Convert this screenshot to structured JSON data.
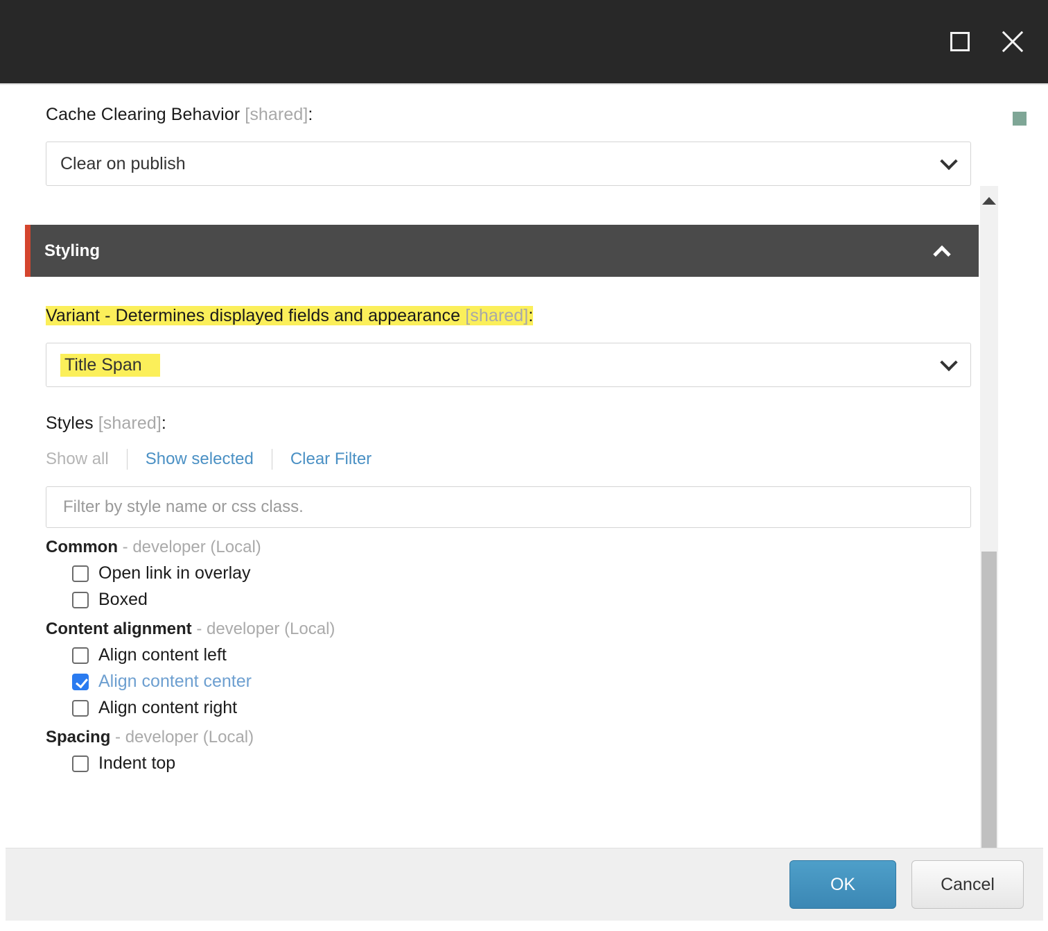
{
  "titlebar": {
    "maximize_icon": "maximize-square-icon",
    "close_icon": "close-x-icon"
  },
  "fields": {
    "cache_clearing": {
      "label": "Cache Clearing Behavior ",
      "label_shared": "[shared]",
      "label_colon": ":",
      "value": "Clear on publish",
      "chevron_icon": "chevron-down-icon"
    }
  },
  "section": {
    "title": "Styling",
    "accent_color": "#d4452e",
    "collapse_icon": "chevron-up-icon",
    "expanded": true
  },
  "variant": {
    "label": "Variant - Determines displayed fields and appearance ",
    "label_shared": "[shared]",
    "label_colon": ":",
    "value": "Title Span",
    "chevron_icon": "chevron-down-icon",
    "highlight_color": "#fbef5a"
  },
  "styles": {
    "label": "Styles ",
    "label_shared": "[shared]",
    "label_colon": ":",
    "links": {
      "show_all": "Show all",
      "show_selected": "Show selected",
      "clear_filter": "Clear Filter"
    },
    "filter_placeholder": "Filter by style name or css class.",
    "filter_value": "",
    "groups": [
      {
        "name": "Common",
        "meta": " - developer (Local)",
        "options": [
          {
            "label": "Open link in overlay",
            "checked": false
          },
          {
            "label": "Boxed",
            "checked": false
          }
        ]
      },
      {
        "name": "Content alignment",
        "meta": " - developer (Local)",
        "options": [
          {
            "label": "Align content left",
            "checked": false
          },
          {
            "label": "Align content center",
            "checked": true
          },
          {
            "label": "Align content right",
            "checked": false
          }
        ]
      },
      {
        "name": "Spacing",
        "meta": " - developer (Local)",
        "options": [
          {
            "label": "Indent top",
            "checked": false
          }
        ]
      }
    ]
  },
  "scrollbar": {
    "up_arrow_icon": "scroll-up-arrow-icon",
    "down_arrow_icon": "scroll-down-arrow-icon",
    "marker_color": "#7fa696"
  },
  "footer": {
    "ok_label": "OK",
    "cancel_label": "Cancel",
    "ok_color": "#3b87b4"
  }
}
